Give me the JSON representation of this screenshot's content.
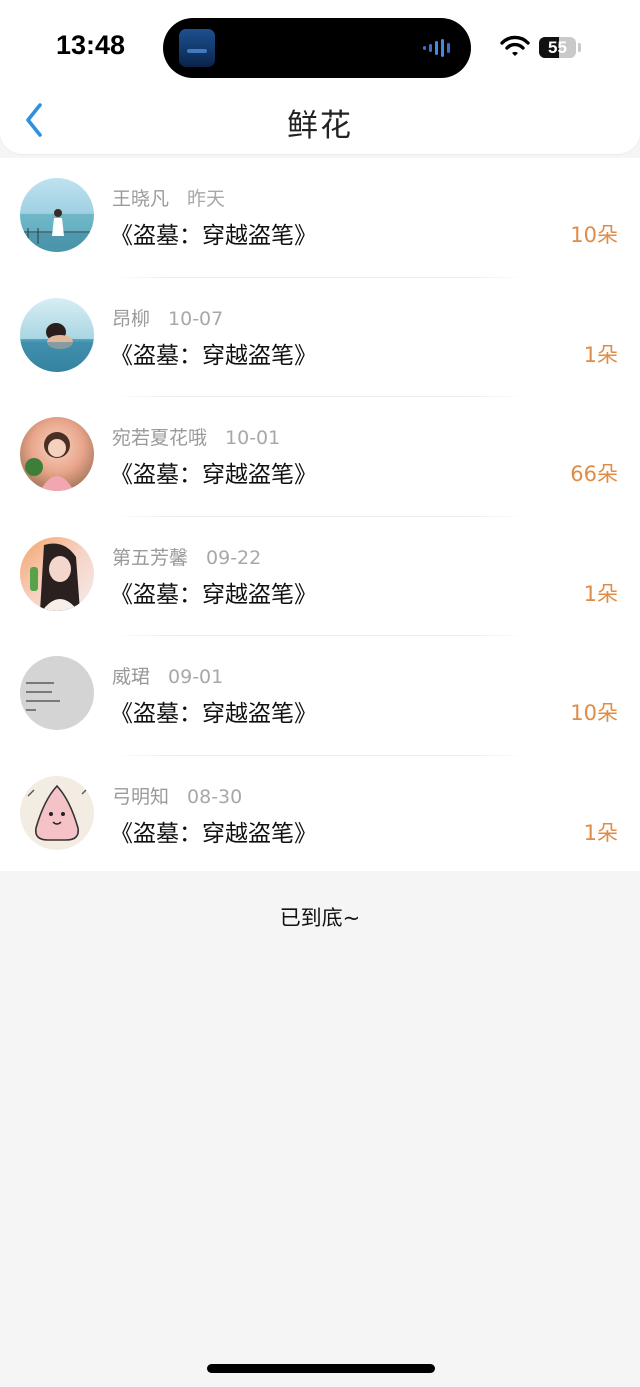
{
  "status_bar": {
    "time": "13:48",
    "battery_level": "55",
    "battery_fraction": 0.55
  },
  "nav": {
    "title": "鲜花",
    "back_icon": "chevron-left-icon",
    "accent_color": "#2f8fe0"
  },
  "list": {
    "count_color": "#e08c45",
    "items": [
      {
        "name": "王晓凡",
        "date": "昨天",
        "book": "《盗墓：穿越盗笔》",
        "count": "10朵"
      },
      {
        "name": "昂柳",
        "date": "10-07",
        "book": "《盗墓：穿越盗笔》",
        "count": "1朵"
      },
      {
        "name": "宛若夏花哦",
        "date": "10-01",
        "book": "《盗墓：穿越盗笔》",
        "count": "66朵"
      },
      {
        "name": "第五芳馨",
        "date": "09-22",
        "book": "《盗墓：穿越盗笔》",
        "count": "1朵"
      },
      {
        "name": "威珺",
        "date": "09-01",
        "book": "《盗墓：穿越盗笔》",
        "count": "10朵"
      },
      {
        "name": "弓明知",
        "date": "08-30",
        "book": "《盗墓：穿越盗笔》",
        "count": "1朵"
      }
    ]
  },
  "footer": {
    "end_text": "已到底~"
  }
}
